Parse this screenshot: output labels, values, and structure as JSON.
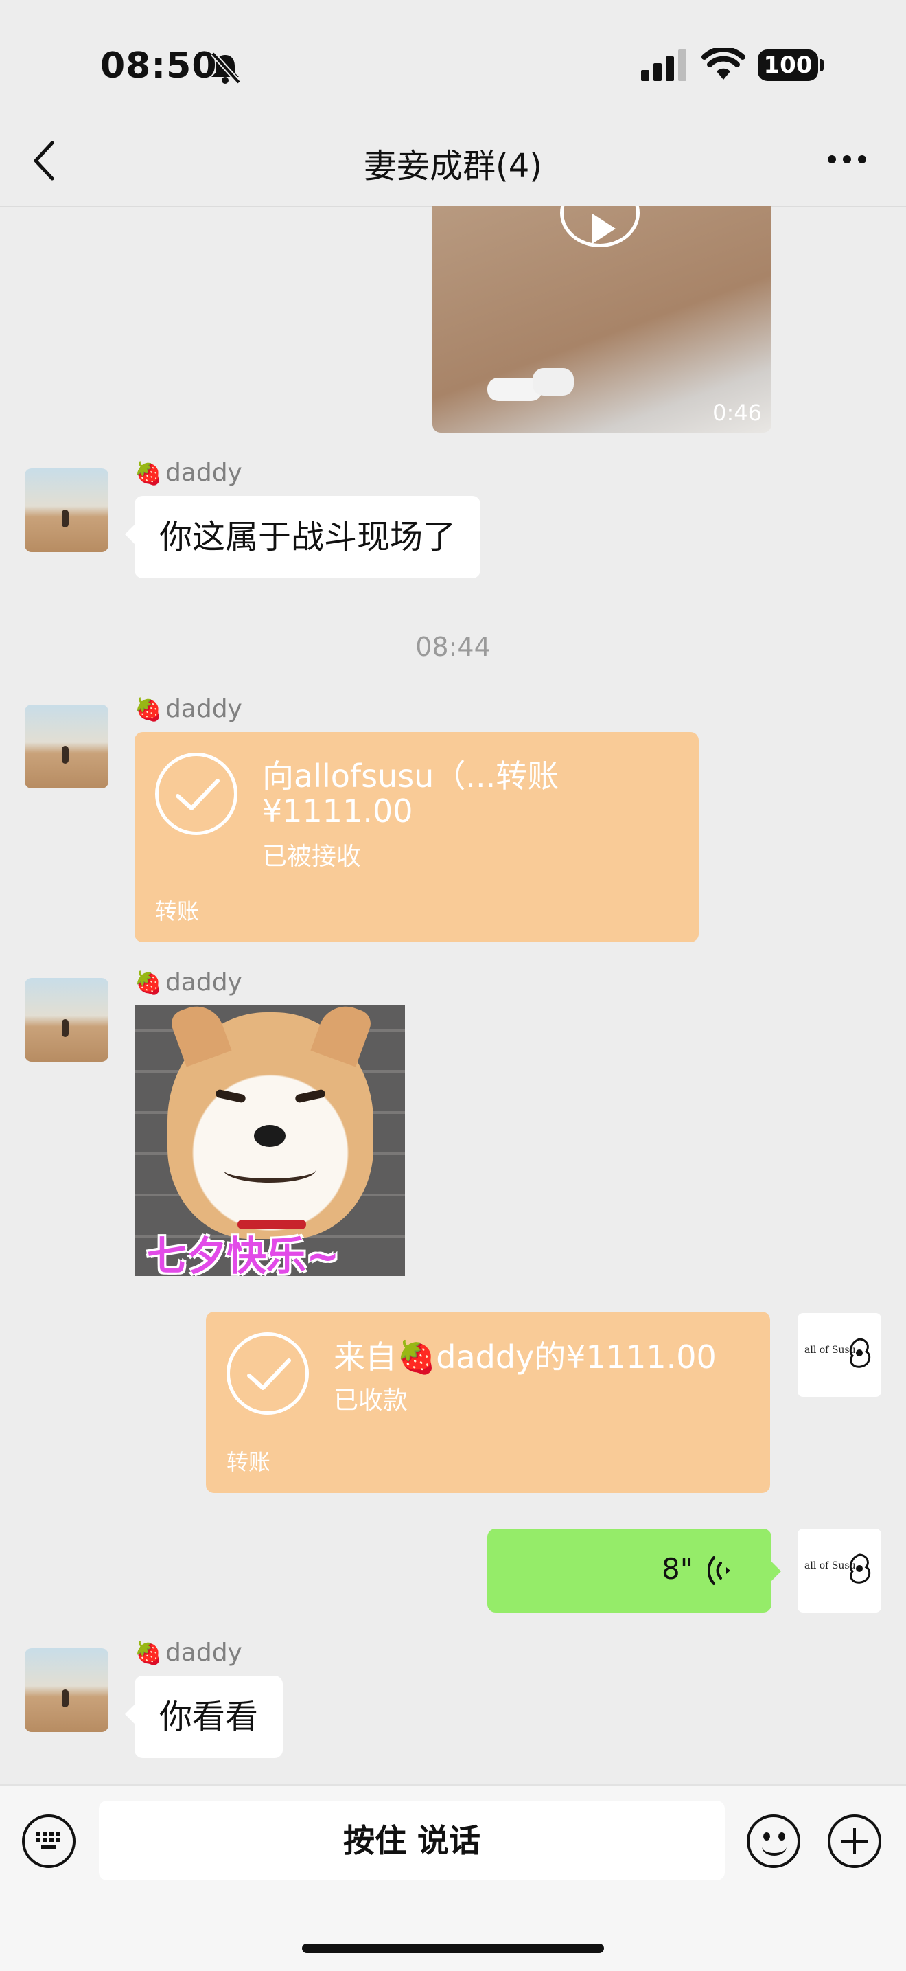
{
  "status_bar": {
    "time": "08:50",
    "battery": "100"
  },
  "nav": {
    "title": "妻妾成群(4)",
    "back_icon": "chevron-left-icon",
    "more_icon": "more-dots-icon"
  },
  "messages": {
    "video": {
      "duration": "0:46"
    },
    "m1": {
      "sender": "daddy",
      "text": "你这属于战斗现场了"
    },
    "timestamp": "08:44",
    "m2": {
      "sender": "daddy",
      "line1": "向allofsusu（...转账",
      "amount": "¥1111.00",
      "status": "已被接收",
      "footer": "转账"
    },
    "m3": {
      "sender": "daddy",
      "sticker_text": "七夕快乐~"
    },
    "m4": {
      "line_prefix": "来自",
      "line_name": "daddy的¥1111.00",
      "status": "已收款",
      "footer": "转账"
    },
    "m5": {
      "duration": "8\""
    },
    "m6": {
      "sender": "daddy",
      "text": "你看看"
    }
  },
  "my_avatar_text": "all of Susu",
  "input_bar": {
    "hold_to_talk": "按住 说话"
  },
  "colors": {
    "background": "#ededed",
    "transfer": "#f9cb97",
    "voice_bubble": "#95ec69"
  }
}
